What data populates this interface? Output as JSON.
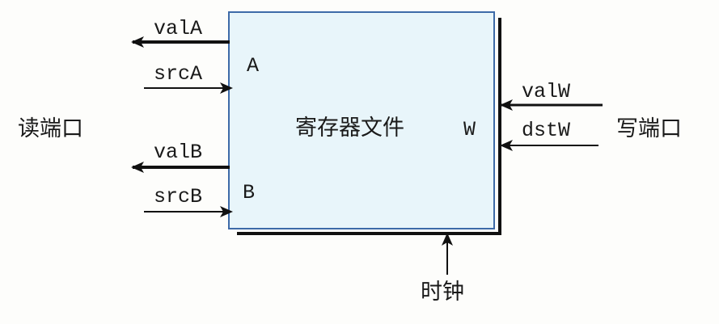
{
  "title": "寄存器文件",
  "read_port_label": "读端口",
  "write_port_label": "写端口",
  "clock_label": "时钟",
  "ports": {
    "A": "A",
    "B": "B",
    "W": "W"
  },
  "signals": {
    "valA": "valA",
    "srcA": "srcA",
    "valB": "valB",
    "srcB": "srcB",
    "valW": "valW",
    "dstW": "dstW"
  },
  "colors": {
    "box_fill": "#e8f5fa",
    "box_border": "#3d6aa8",
    "line": "#111111"
  }
}
